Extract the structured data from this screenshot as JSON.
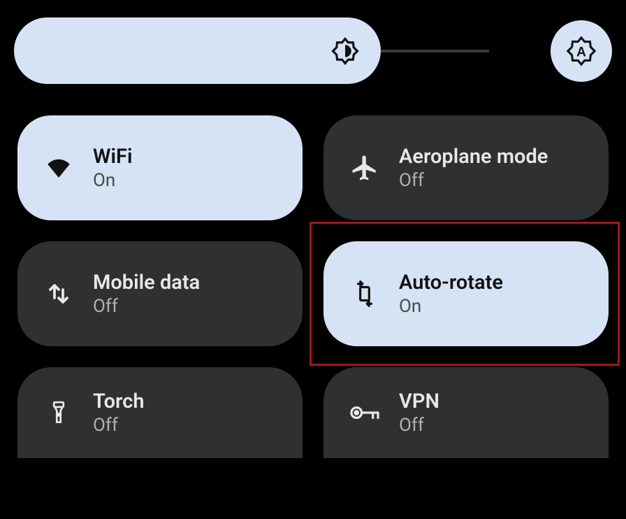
{
  "brightness": {
    "level_percent": 75,
    "auto": true
  },
  "tiles": {
    "wifi": {
      "title": "WiFi",
      "status": "On",
      "state": "on"
    },
    "airplane": {
      "title": "Aeroplane mode",
      "status": "Off",
      "state": "off"
    },
    "mobile_data": {
      "title": "Mobile data",
      "status": "Off",
      "state": "off"
    },
    "auto_rotate": {
      "title": "Auto-rotate",
      "status": "On",
      "state": "on"
    },
    "torch": {
      "title": "Torch",
      "status": "Off",
      "state": "off"
    },
    "vpn": {
      "title": "VPN",
      "status": "Off",
      "state": "off"
    }
  },
  "highlighted_tile": "auto_rotate",
  "colors": {
    "tile_on_bg": "#d6e3f5",
    "tile_off_bg": "#2e3032",
    "highlight_border": "#a01818"
  }
}
